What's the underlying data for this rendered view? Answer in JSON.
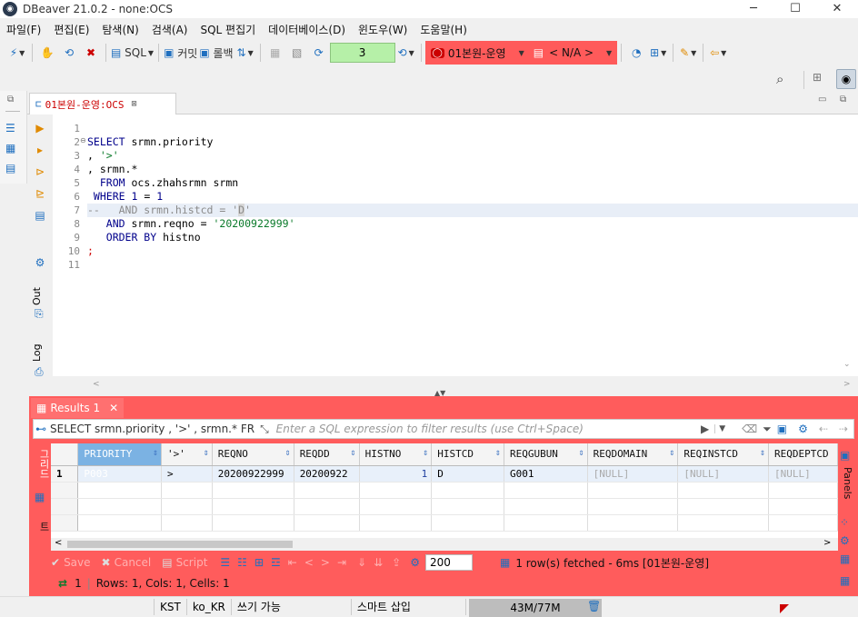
{
  "window": {
    "title": "DBeaver 21.0.2 - none:OCS",
    "min": "─",
    "max": "☐",
    "close": "✕"
  },
  "menu": [
    "파일(F)",
    "편집(E)",
    "탐색(N)",
    "검색(A)",
    "SQL 편집기",
    "데이터베이스(D)",
    "윈도우(W)",
    "도움말(H)"
  ],
  "toolbar": {
    "sql_label": "SQL",
    "commit_label": "커밋",
    "rollback_label": "롤백",
    "txn_count": "3",
    "datasource": "01본원-운영",
    "schema": "< N/A >"
  },
  "editor_tab": {
    "label": "01본원-운영:OCS"
  },
  "side_tabs": {
    "out": "Out",
    "log": "Log"
  },
  "editor": {
    "line_numbers": [
      "1",
      "2",
      "3",
      "4",
      "5",
      "6",
      "7",
      "8",
      "9",
      "10",
      "11"
    ]
  },
  "results": {
    "tab_label": "Results 1",
    "filter_query": "SELECT srmn.priority , '>' , srmn.* FR",
    "filter_placeholder": "Enter a SQL expression to filter results (use Ctrl+Space)",
    "columns": [
      "PRIORITY",
      "'>'",
      "REQNO",
      "REQDD",
      "HISTNO",
      "HISTCD",
      "REQGUBUN",
      "REQDOMAIN",
      "REQINSTCD",
      "REQDEPTCD"
    ],
    "rows": [
      {
        "num": "1",
        "cells": [
          "P003",
          ">",
          "20200922999",
          "20200922",
          "1",
          "D",
          "G001",
          "[NULL]",
          "[NULL]",
          "[NULL]"
        ]
      }
    ],
    "side_labels": {
      "grid": "그리드",
      "text": "텍스트",
      "panels": "Panels"
    },
    "save_label": "Save",
    "cancel_label": "Cancel",
    "script_label": "Script",
    "max_rows": "200",
    "fetch_status": "1 row(s) fetched - 6ms [01본원-운영]",
    "row_info_count": "1",
    "row_info": "Rows: 1, Cols: 1, Cells: 1"
  },
  "statusbar": {
    "timezone": "KST",
    "locale": "ko_KR",
    "write_mode": "쓰기 가능",
    "insert_mode": "스마트 삽입",
    "memory": "43M/77M"
  }
}
